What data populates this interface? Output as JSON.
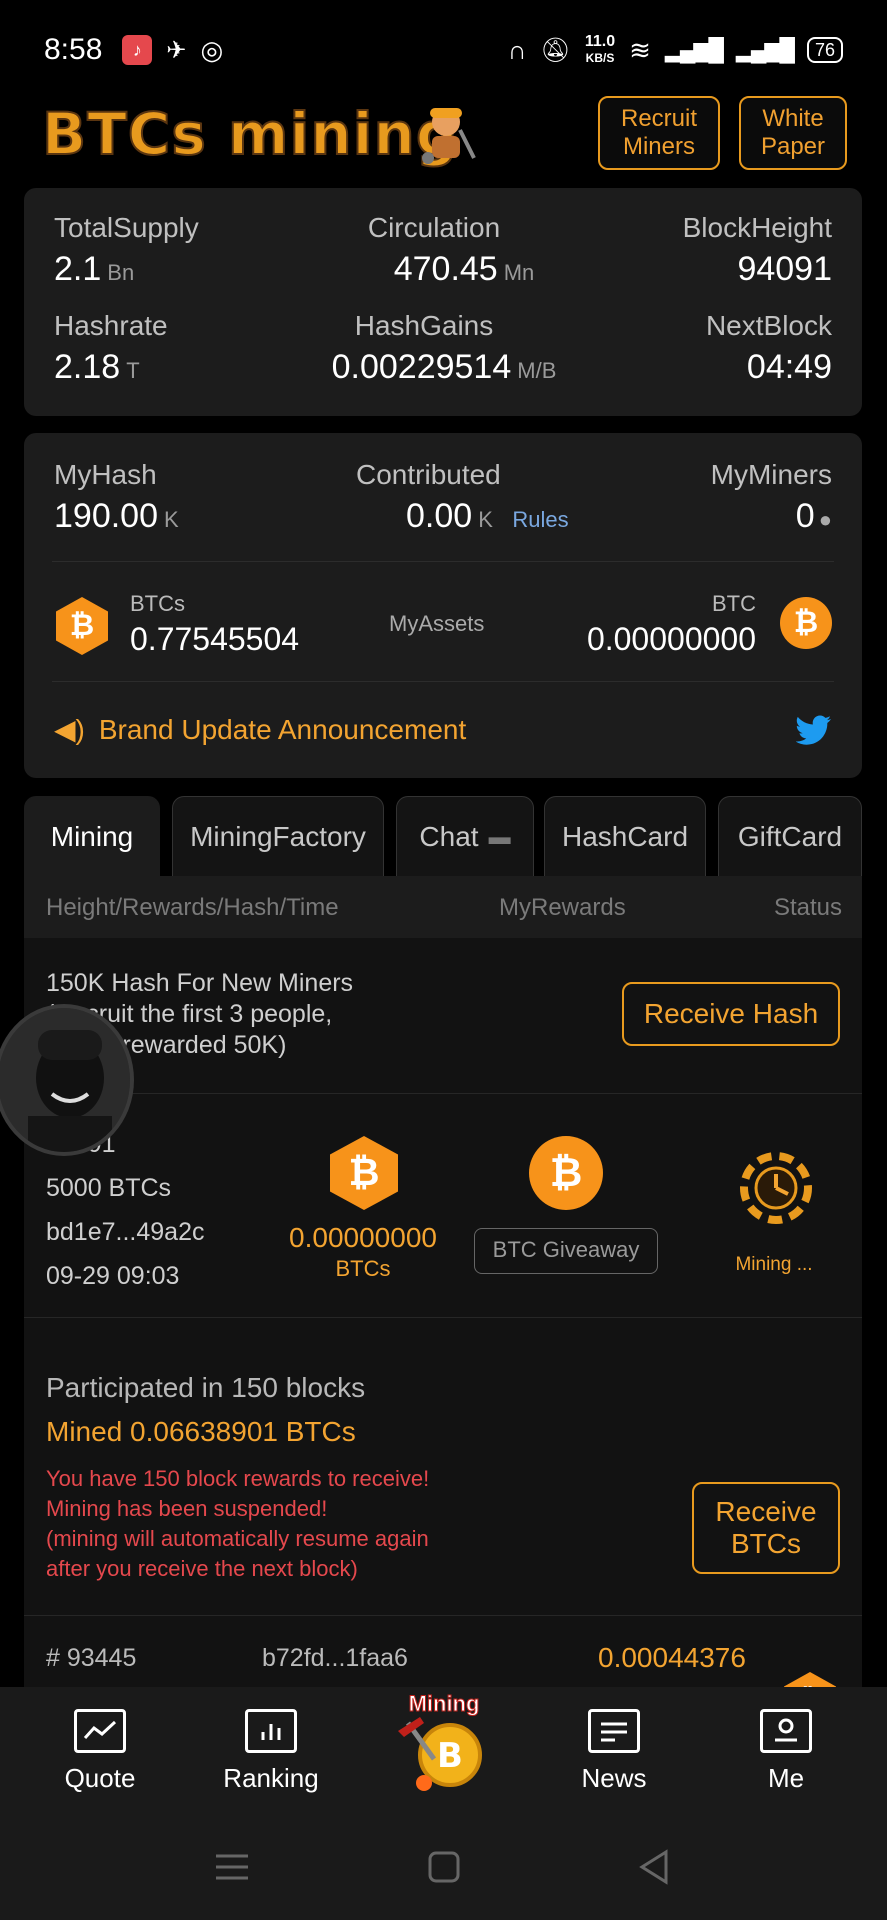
{
  "status_bar": {
    "time": "8:58",
    "net_speed_value": "11.0",
    "net_speed_unit": "KB/S",
    "battery": "76"
  },
  "header": {
    "logo": "BTCs mining",
    "recruit_line1": "Recruit",
    "recruit_line2": "Miners",
    "white_line1": "White",
    "white_line2": "Paper"
  },
  "stats": {
    "total_supply": {
      "label": "TotalSupply",
      "value": "2.1",
      "unit": "Bn"
    },
    "circulation": {
      "label": "Circulation",
      "value": "470.45",
      "unit": "Mn"
    },
    "block_height": {
      "label": "BlockHeight",
      "value": "94091"
    },
    "hashrate": {
      "label": "Hashrate",
      "value": "2.18",
      "unit": "T"
    },
    "hash_gains": {
      "label": "HashGains",
      "value": "0.00229514",
      "unit": "M/B"
    },
    "next_block": {
      "label": "NextBlock",
      "value": "04:49"
    }
  },
  "mine": {
    "my_hash": {
      "label": "MyHash",
      "value": "190.00",
      "unit": "K"
    },
    "contributed": {
      "label": "Contributed",
      "value": "0.00",
      "unit": "K",
      "rules": "Rules"
    },
    "my_miners": {
      "label": "MyMiners",
      "value": "0"
    },
    "btcs": {
      "label": "BTCs",
      "value": "0.77545504"
    },
    "my_assets": "MyAssets",
    "btc": {
      "label": "BTC",
      "value": "0.00000000"
    },
    "announcement": "Brand Update Announcement"
  },
  "tabs": [
    "Mining",
    "MiningFactory",
    "Chat",
    "HashCard",
    "GiftCard"
  ],
  "table": {
    "col_height": "Height/Rewards/Hash/Time",
    "col_rewards": "MyRewards",
    "col_status": "Status"
  },
  "promo": {
    "line1": "150K Hash For New Miners",
    "line2": "(Recruit the first 3 people,",
    "line3": "will be rewarded 50K)",
    "button": "Receive Hash"
  },
  "current_block": {
    "height": "94091",
    "reward": "5000 BTCs",
    "hash": "bd1e7...49a2c",
    "time": "09-29 09:03",
    "my_reward": "0.00000000",
    "my_reward_unit": "BTCs",
    "giveaway": "BTC Giveaway",
    "status": "Mining ..."
  },
  "summary": {
    "participated": "Participated in 150 blocks",
    "mined": "Mined 0.06638901 BTCs",
    "warn1": "You have 150 block rewards to receive!",
    "warn2": "Mining has been suspended!",
    "warn3": "(mining will automatically resume again",
    "warn4": "after you receive the next block)",
    "button_line1": "Receive",
    "button_line2": "BTCs"
  },
  "prev_block": {
    "height": "# 93445",
    "hash": "b72fd...1faa6",
    "reward": "0.00044376"
  },
  "bottom_nav": {
    "quote": "Quote",
    "ranking": "Ranking",
    "mining": "Mining",
    "news": "News",
    "me": "Me"
  },
  "colors": {
    "accent": "#f3a431",
    "bitcoin": "#f7931a",
    "warning": "#e5484d",
    "card": "#1c1c1c",
    "background": "#000000"
  }
}
